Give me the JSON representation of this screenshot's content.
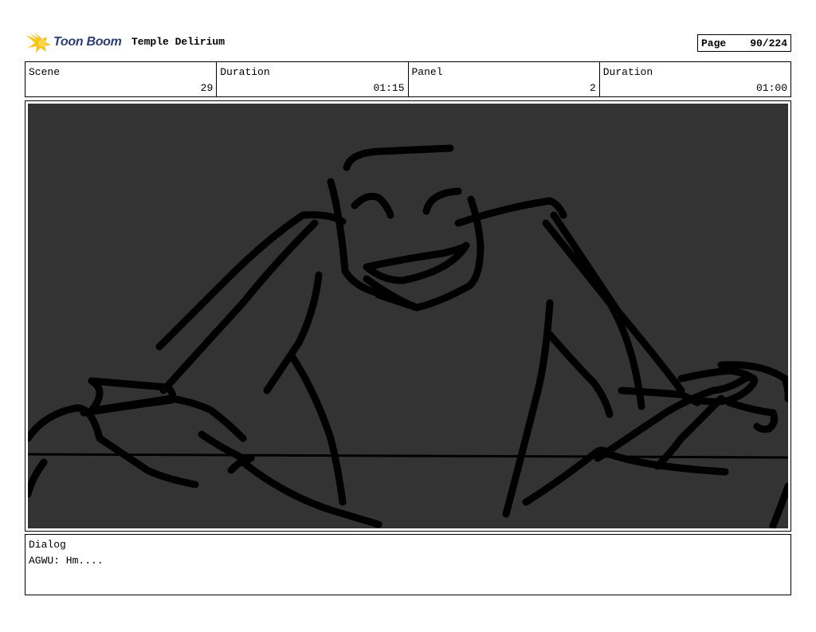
{
  "header": {
    "logo_text": "Toon Boom",
    "project_title": "Temple Delirium",
    "page_label": "Page",
    "page_value": "90/224"
  },
  "info": {
    "scene_label": "Scene",
    "scene_value": "29",
    "scene_duration_label": "Duration",
    "scene_duration_value": "01:15",
    "panel_label": "Panel",
    "panel_value": "2",
    "panel_duration_label": "Duration",
    "panel_duration_value": "01:00"
  },
  "dialog": {
    "label": "Dialog",
    "text": "AGWU: Hm...."
  },
  "colors": {
    "panel_background": "#333333",
    "sketch_stroke": "#000000",
    "logo_star": "#f7c21b",
    "logo_text": "#2c3e73"
  }
}
